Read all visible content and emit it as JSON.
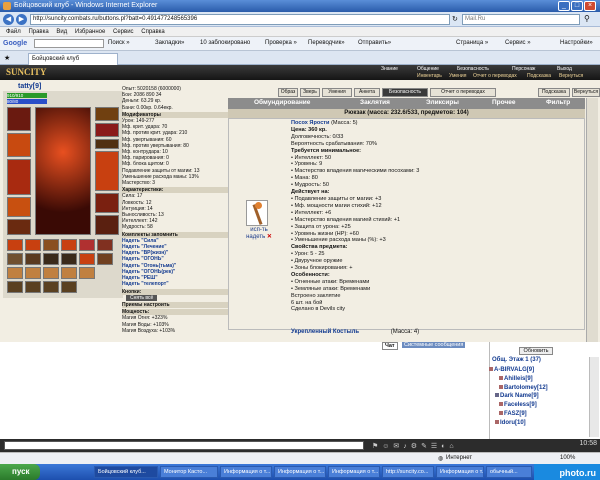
{
  "window": {
    "title": "Бойцовский клуб - Windows Internet Explorer"
  },
  "address": {
    "url": "http://suncity.combats.ru/buttons.pl?batt=0.491477248565396",
    "search_placeholder": "Mail.Ru"
  },
  "menu": [
    "Файл",
    "Правка",
    "Вид",
    "Избранное",
    "Сервис",
    "Справка"
  ],
  "toolbar": {
    "google": "Google",
    "search": "Поиск »",
    "bookmarks": "Закладки»",
    "blocked": "10 заблокировано",
    "check": "Проверка »",
    "translate": "Переводчик»",
    "send": "Отправить»",
    "page": "Страница »",
    "service": "Сервис »",
    "settings": "Настройки»"
  },
  "tab": {
    "label": "Бойцовский клуб"
  },
  "game": {
    "logo": "SUNCITY",
    "topmenu": {
      "main": [
        "Знание",
        "Общение",
        "Безопасность",
        "Персонаж",
        "Выход"
      ],
      "sub": [
        "Инвентарь",
        "Умения",
        "Отчет о переводах",
        "Подсказка",
        "Вернуться"
      ]
    },
    "right_buttons": [
      "Образ",
      "Зверь",
      "Умения",
      "Анкета",
      "Безопасность",
      "Отчет о переводах",
      "Подсказка",
      "Вернуться"
    ]
  },
  "player": {
    "name": "tatty",
    "level": "[9]",
    "hp": "910/910",
    "mana": "80/80"
  },
  "stats": {
    "lines": [
      "Опыт: 5020158 (6000000)",
      "Бои: 2086 890 34",
      "Деньги: 63.29 кр.",
      "Бани: 0.00кр. 0.64екр.",
      "Модификаторы",
      "Урон: 149-277",
      "Мф. крит. удара: 70",
      "Мф. против крит. удара: 210",
      "Мф. увертывания: 60",
      "Мф. против увертывания: 80",
      "Мф. контрудара: 10",
      "Мф. парирования: 0",
      "Мф. блока щитом: 0",
      "Подавление защиты от магии: 13",
      "Уменьшение расхода маны: 13%",
      "Мастерство: 3",
      "Характеристики:",
      "Сила: 17",
      "Ловкость: 12",
      "Интуиция: 14",
      "Выносливость: 13",
      "Интеллект: 142",
      "Мудрость: 58",
      "Комплекты запомнить",
      "Надеть \"Сила\"",
      "Надеть \"Лечение\"",
      "Надеть \"ВР(жизн)\"",
      "Надеть \"ОГОНЬ\"",
      "Надеть \"Огонь(тьма)\"",
      "Надеть \"ОГОНЬ(рек)\"",
      "Надеть \"РЕШ\"",
      "Надеть \"телепорт\"",
      "Кнопки:",
      "Снять всё",
      "Приемы настроить",
      "Мощность:",
      "Магия Огня: +323%",
      "Магия Воды: +103%",
      "Магия Воздуха: +103%"
    ]
  },
  "inventory": {
    "tabs": [
      "Обмундирование",
      "Заклятия",
      "Эликсиры",
      "Прочее",
      "Фильтр"
    ],
    "header": "Рюкзак (масса: 232.6/533, предметов: 104)"
  },
  "item": {
    "title": "Посох Ярости",
    "mass": "(Масса: 5)",
    "use": "исп-ть",
    "wear": "надеть",
    "lines": [
      "Цена: 360 кр.",
      "Долговечность: 0/33",
      "Вероятность срабатывания: 70%",
      "Требуется минимальное:",
      "• Интеллект: 50",
      "• Уровень: 9",
      "• Мастерство владения магическими посохами: 3",
      "• Мана: 80",
      "• Мудрость: 50",
      "Действует на:",
      "• Подавление защиты от магии: +3",
      "• Мф. мощности магии стихий: +12",
      "• Интеллект: +6",
      "• Мастерство владения магией стихий: +1",
      "• Защита от урона: +25",
      "• Уровень жизни (HP): +60",
      "• Уменьшение расхода маны (%): +3",
      "Свойства предмета:",
      "• Урон: 5 - 25",
      "• Двуручное оружие",
      "• Зоны блокирования: +",
      "Особенности:",
      "• Огненные атаки: Временами",
      "• Земляные атаки: Временами",
      "Встроено заклятие",
      "6 шт. на бой",
      "Сделано в Devils city"
    ],
    "next": "Укрепленный Костыль",
    "next_mass": "(Масса: 4)"
  },
  "chat": {
    "tabs": [
      "Чат",
      "Системные сообщения"
    ],
    "update": "Обновить",
    "location": "Общ. Этаж 1 (37)",
    "users": [
      "A-BIRVALG[9]",
      "Ahilleis[9]",
      "Bartolomey[12]",
      "Dark Name[9]",
      "Faceless[9]",
      "FASZ[9]",
      "Idoru[10]"
    ],
    "clock": "10:58"
  },
  "statusbar": {
    "text": "Интернет",
    "zoom": "100%",
    "watermark": "photo.ru"
  },
  "taskbar": {
    "start": "пуск",
    "tasks": [
      "Бойцовский клуб...",
      "Монитор Касто...",
      "Информация о т...",
      "Информация о т...",
      "Информация о т...",
      "http://suncity.co...",
      "Информация о т...",
      "обычный..."
    ]
  }
}
